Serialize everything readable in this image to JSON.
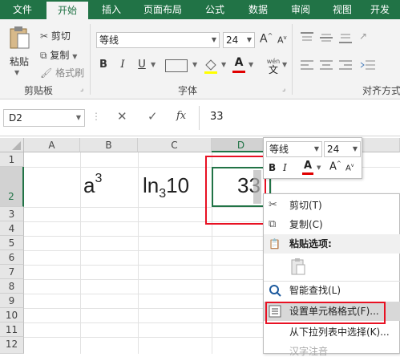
{
  "tabs": [
    "文件",
    "开始",
    "插入",
    "页面布局",
    "公式",
    "数据",
    "审阅",
    "视图",
    "开发"
  ],
  "ribbon": {
    "paste": "粘贴",
    "cut": "剪切",
    "copy": "复制",
    "format_painter": "格式刷",
    "clipboard_group": "剪贴板",
    "font_name": "等线",
    "font_size": "24",
    "font_group": "字体",
    "align_group": "对齐方式",
    "bold": "B",
    "italic": "I",
    "underline": "U",
    "font_color": "A",
    "grow": "A",
    "shrink": "A",
    "wen": "wén",
    "wen_char": "文"
  },
  "formula_bar": {
    "name_box": "D2",
    "cancel": "✕",
    "enter": "✓",
    "fx": "fx",
    "value": "33"
  },
  "columns": [
    "A",
    "B",
    "C",
    "D"
  ],
  "rows": [
    "1",
    "2",
    "3",
    "4",
    "5",
    "6",
    "7",
    "8",
    "9",
    "10",
    "11",
    "12"
  ],
  "cells": {
    "b2_base": "a",
    "b2_sup": "3",
    "c2_base": "ln",
    "c2_sub": "3",
    "c2_tail": "10",
    "d2": "33"
  },
  "mini_toolbar": {
    "font_name": "等线",
    "font_size": "24",
    "bold": "B",
    "italic": "I",
    "font_color": "A",
    "grow": "A",
    "shrink": "A"
  },
  "context_menu": {
    "cut": "剪切(T)",
    "copy": "复制(C)",
    "paste_options": "粘贴选项:",
    "smart_lookup": "智能查找(L)",
    "format_cells": "设置单元格格式(F)...",
    "pick_list": "从下拉列表中选择(K)...",
    "phonetic": "汉字注音"
  },
  "colors": {
    "excel_green": "#217346",
    "highlight_red": "#e81123",
    "font_color_red": "#e00000"
  }
}
